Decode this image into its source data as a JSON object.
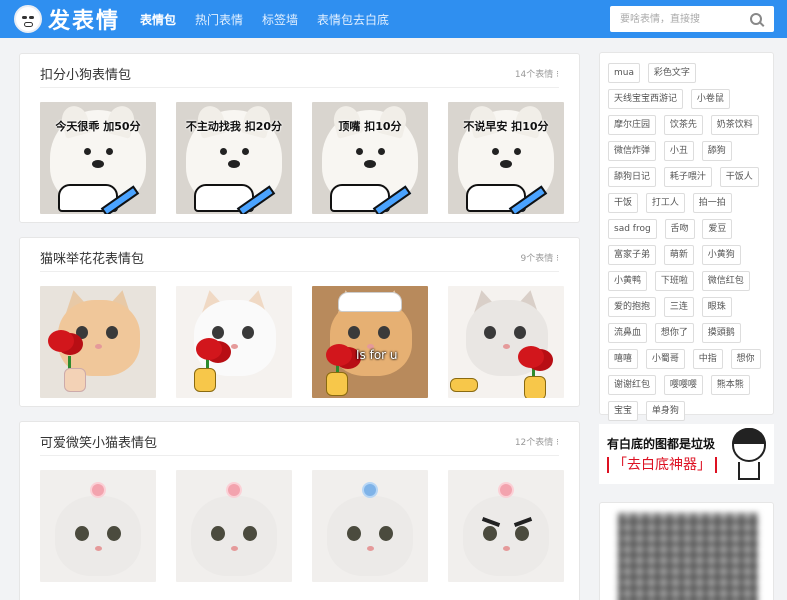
{
  "header": {
    "logo_text": "发表情",
    "nav": [
      "表情包",
      "热门表情",
      "标签墙",
      "表情包去白底"
    ],
    "search_placeholder": "要啥表情，直接搜"
  },
  "sections": [
    {
      "title": "扣分小狗表情包",
      "count": "14个表情",
      "captions": [
        "今天很乖 加50分",
        "不主动找我 扣20分",
        "顶嘴 扣10分",
        "不说早安 扣10分"
      ]
    },
    {
      "title": "猫咪举花花表情包",
      "count": "9个表情",
      "captions": [
        "",
        "",
        "Is for u",
        ""
      ]
    },
    {
      "title": "可爱微笑小猫表情包",
      "count": "12个表情",
      "captions": [
        "",
        "",
        "",
        ""
      ]
    }
  ],
  "sidebar": {
    "tags": [
      "mua",
      "彩色文字",
      "天线宝宝西游记",
      "小卷鼠",
      "摩尔庄园",
      "饮茶先",
      "奶茶饮料",
      "微信炸弹",
      "小丑",
      "舔狗",
      "舔狗日记",
      "耗子喂汁",
      "干饭人",
      "干饭",
      "打工人",
      "拍一拍",
      "sad frog",
      "舌吻",
      "爱豆",
      "富家子弟",
      "萌新",
      "小黄狗",
      "小黄鸭",
      "下班啦",
      "微信红包",
      "爱的抱抱",
      "三连",
      "眼珠",
      "流鼻血",
      "想你了",
      "摸頭鹅",
      "嘻嘻",
      "小蜀哥",
      "中指",
      "想你",
      "谢谢红包",
      "嘤嘤嘤",
      "熊本熊",
      "宝宝",
      "单身狗"
    ],
    "banner_line1": "有白底的图都是垃圾",
    "banner_line2": "「去白底神器」"
  }
}
